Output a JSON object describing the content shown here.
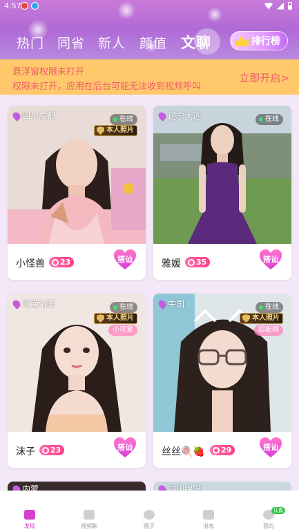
{
  "status_bar": {
    "time": "4:57"
  },
  "tabs": [
    {
      "label": "热门",
      "active": false
    },
    {
      "label": "同省",
      "active": false
    },
    {
      "label": "新人",
      "active": false
    },
    {
      "label": "颜值",
      "active": false
    },
    {
      "label": "文聊",
      "active": true
    }
  ],
  "rank_button": {
    "label": "排行榜",
    "icon": "crown-icon"
  },
  "notice": {
    "line1": "悬浮窗权限未打开",
    "line2": "权限未打开，应用在后台可能无法收到视频呼叫",
    "action": "立即开启>"
  },
  "cards": [
    {
      "location": "四川成都",
      "online": "在线",
      "verified": "本人照片",
      "tagline": "",
      "name": "小怪兽",
      "level": "23",
      "chat_label": "搭讪"
    },
    {
      "location": "辽宁大连",
      "online": "在线",
      "verified": "",
      "tagline": "",
      "name": "雅媛",
      "level": "35",
      "chat_label": "搭讪"
    },
    {
      "location": "河南洛阳",
      "online": "在线",
      "verified": "本人照片",
      "tagline": "小可爱",
      "name": "沫子",
      "level": "23",
      "chat_label": "搭讪"
    },
    {
      "location": "中国",
      "online": "在线",
      "verified": "本人照片",
      "tagline": "超能卿",
      "name": "丝丝🍭🍓",
      "level": "29",
      "chat_label": "搭讪"
    }
  ],
  "peek_cards": [
    {
      "location": "内蒙"
    },
    {
      "location": "四川绵阳"
    }
  ],
  "bottom_nav": [
    {
      "label": "发现",
      "active": true,
      "icon": "home-icon"
    },
    {
      "label": "视频聊",
      "active": false,
      "icon": "video-icon"
    },
    {
      "label": "圈子",
      "active": false,
      "icon": "circle-icon"
    },
    {
      "label": "消息",
      "active": false,
      "icon": "message-icon"
    },
    {
      "label": "我的",
      "active": false,
      "icon": "profile-icon",
      "badge": "认真"
    }
  ],
  "colors": {
    "accent": "#d63fd0",
    "notice_bg": "#ffc96b",
    "notice_text": "#ee5b6c"
  }
}
